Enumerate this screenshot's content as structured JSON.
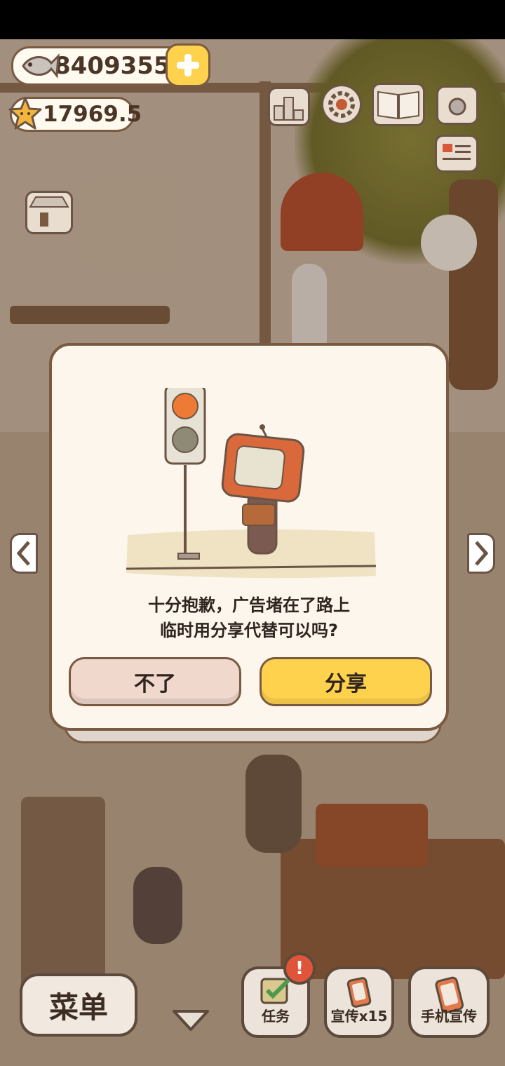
{
  "hud": {
    "fish_count": "8409355",
    "star_count": "17969.5"
  },
  "dialog": {
    "message_line1": "十分抱歉，广告堵在了路上",
    "message_line2": "临时用分享代替可以吗?",
    "decline_label": "不了",
    "share_label": "分享"
  },
  "bottom_bar": {
    "menu_label": "菜单",
    "tasks_label": "任务",
    "tasks_badge": "!",
    "promo_label": "宣传x15",
    "phone_promo_label": "手机宣传"
  },
  "colors": {
    "accent_yellow": "#ffd24e",
    "outline_brown": "#7a5a40",
    "decline_pink": "#f0d8cd",
    "dialog_bg": "#fdf6ec",
    "badge_red": "#e0553a"
  },
  "icons": [
    "fish-icon",
    "star-icon",
    "plus-icon",
    "leaderboard-icon",
    "settings-gear-icon",
    "recipe-book-icon",
    "camera-icon",
    "newspaper-icon",
    "shop-icon",
    "left-arrow-icon",
    "right-arrow-icon",
    "down-arrow-icon",
    "task-check-icon",
    "promo-phone-icon"
  ]
}
